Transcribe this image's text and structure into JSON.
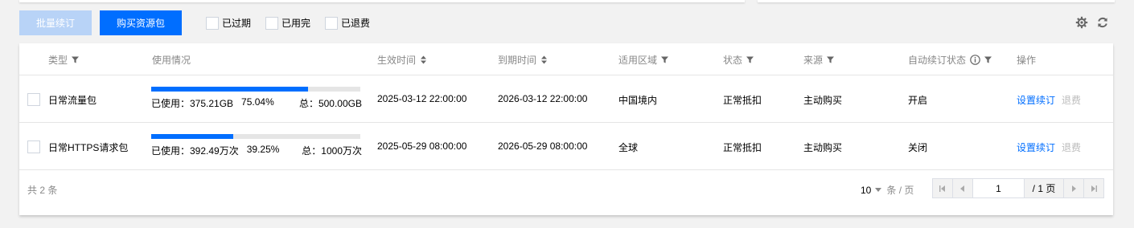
{
  "toolbar": {
    "renew_label": "批量续订",
    "buy_label": "购买资源包",
    "filters": [
      {
        "label": "已过期",
        "checked": false
      },
      {
        "label": "已用完",
        "checked": false
      },
      {
        "label": "已退费",
        "checked": false
      }
    ],
    "icons": [
      "gear-icon",
      "refresh-icon"
    ]
  },
  "table": {
    "headers": {
      "type": "类型",
      "usage": "使用情况",
      "start": "生效时间",
      "end": "到期时间",
      "region": "适用区域",
      "status": "状态",
      "source": "来源",
      "auto_renew": "自动续订状态",
      "actions": "操作"
    },
    "rows": [
      {
        "type": "日常流量包",
        "used": "已使用：375.21GB",
        "percent": "75.04%",
        "percent_value": 75.04,
        "total": "总：500.00GB",
        "start": "2025-03-12 22:00:00",
        "end": "2026-03-12 22:00:00",
        "region": "中国境内",
        "status": "正常抵扣",
        "source": "主动购买",
        "auto_renew": "开启",
        "action_renew": "设置续订",
        "action_refund": "退费"
      },
      {
        "type": "日常HTTPS请求包",
        "used": "已使用：392.49万次",
        "percent": "39.25%",
        "percent_value": 39.25,
        "total": "总：1000万次",
        "start": "2025-05-29 08:00:00",
        "end": "2026-05-29 08:00:00",
        "region": "全球",
        "status": "正常抵扣",
        "source": "主动购买",
        "auto_renew": "关闭",
        "action_renew": "设置续订",
        "action_refund": "退费"
      }
    ]
  },
  "footer": {
    "count": "共 2 条",
    "page_size": "10",
    "page_size_unit": "条 / 页",
    "page_input": "1",
    "page_total": "/ 1 页"
  },
  "colors": {
    "primary": "#006eff",
    "primary_disabled": "#b8d3f7",
    "header_text": "#888888",
    "link_disabled": "#bbbbbb"
  }
}
